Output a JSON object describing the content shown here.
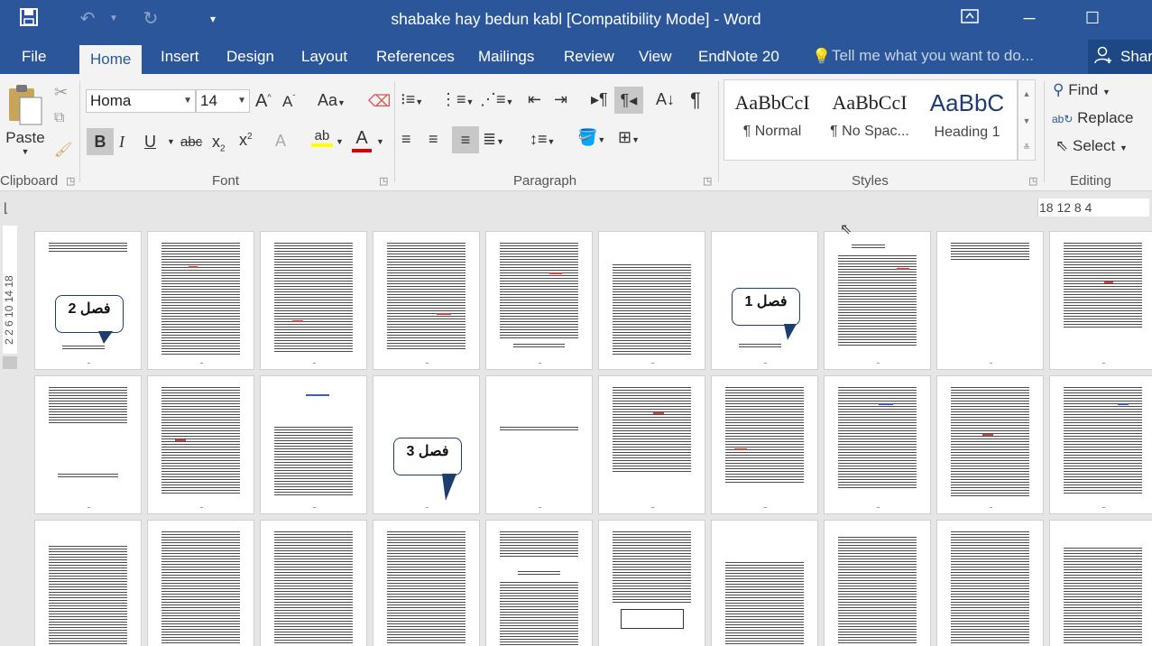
{
  "window": {
    "title": "shabake hay bedun kabl [Compatibility Mode] - Word"
  },
  "tabs": [
    "File",
    "Home",
    "Insert",
    "Design",
    "Layout",
    "References",
    "Mailings",
    "Review",
    "View",
    "EndNote 20"
  ],
  "tell_me": "Tell me what you want to do...",
  "share": "Shar",
  "clipboard": {
    "paste": "Paste",
    "label": "Clipboard"
  },
  "font": {
    "name": "Homa",
    "size": "14",
    "label": "Font",
    "aa": "Aa"
  },
  "paragraph": {
    "label": "Paragraph"
  },
  "styles": {
    "label": "Styles",
    "items": [
      {
        "sample": "AaBbCcI",
        "name": "¶ Normal"
      },
      {
        "sample": "AaBbCcI",
        "name": "¶ No Spac..."
      },
      {
        "sample": "AaBbC",
        "name": "Heading 1"
      }
    ]
  },
  "editing": {
    "label": "Editing",
    "find": "Find",
    "replace": "Replace",
    "select": "Select"
  },
  "ruler": {
    "numbers": "18  12  8  4",
    "vertical": "2  2  6  10  14  18"
  },
  "pages": {
    "callouts": [
      {
        "text": "فصل 2"
      },
      {
        "text": "فصل 1"
      },
      {
        "text": "فصل 3"
      }
    ]
  }
}
